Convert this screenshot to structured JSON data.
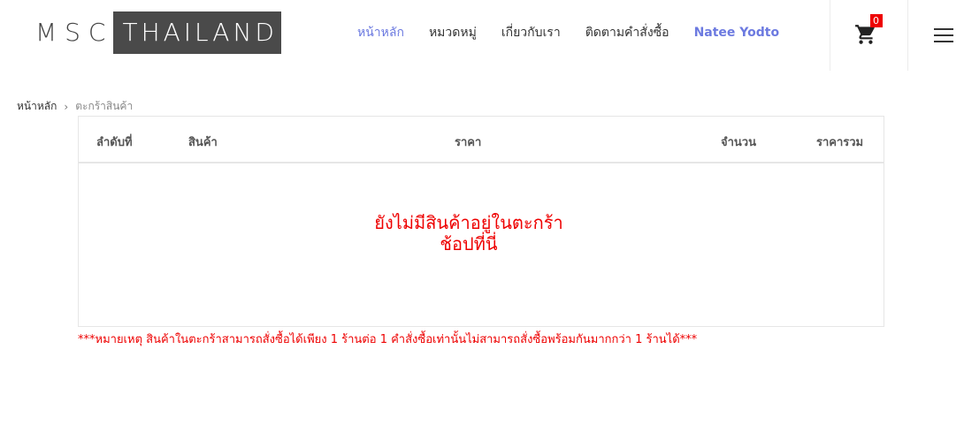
{
  "logo": {
    "left_text": "MSC",
    "right_text": "THAILAND"
  },
  "nav": {
    "items": [
      {
        "label": "หน้าหลัก",
        "active": true
      },
      {
        "label": "หมวดหมู่",
        "active": false
      },
      {
        "label": "เกี่ยวกับเรา",
        "active": false
      },
      {
        "label": "ติดตามคำสั่งซื้อ",
        "active": false
      }
    ],
    "user_name": "Natee Yodto"
  },
  "cart": {
    "icon": "shopping-cart-icon",
    "count": "0"
  },
  "menu": {
    "icon": "hamburger-menu-icon"
  },
  "breadcrumb": {
    "home": "หน้าหลัก",
    "separator": "›",
    "current": "ตะกร้าสินค้า"
  },
  "table": {
    "headers": {
      "order": "ลำดับที่",
      "product": "สินค้า",
      "price": "ราคา",
      "qty": "จำนวน",
      "total": "ราคารวม"
    },
    "empty_message": "ยังไม่มีสินค้าอยู่ในตะกร้า",
    "shop_link": "ช้อปที่นี่"
  },
  "note": "***หมายเหตุ สินค้าในตะกร้าสามารถสั่งซื้อได้เพียง 1 ร้านต่อ 1 คำสั่งซื้อเท่านั้นไม่สามารถสั่งซื้อพร้อมกันมากกว่า 1 ร้านได้***",
  "colors": {
    "accent": "#6c7ae0",
    "alert": "#ee0000",
    "logo_block": "#4a4a4a"
  }
}
